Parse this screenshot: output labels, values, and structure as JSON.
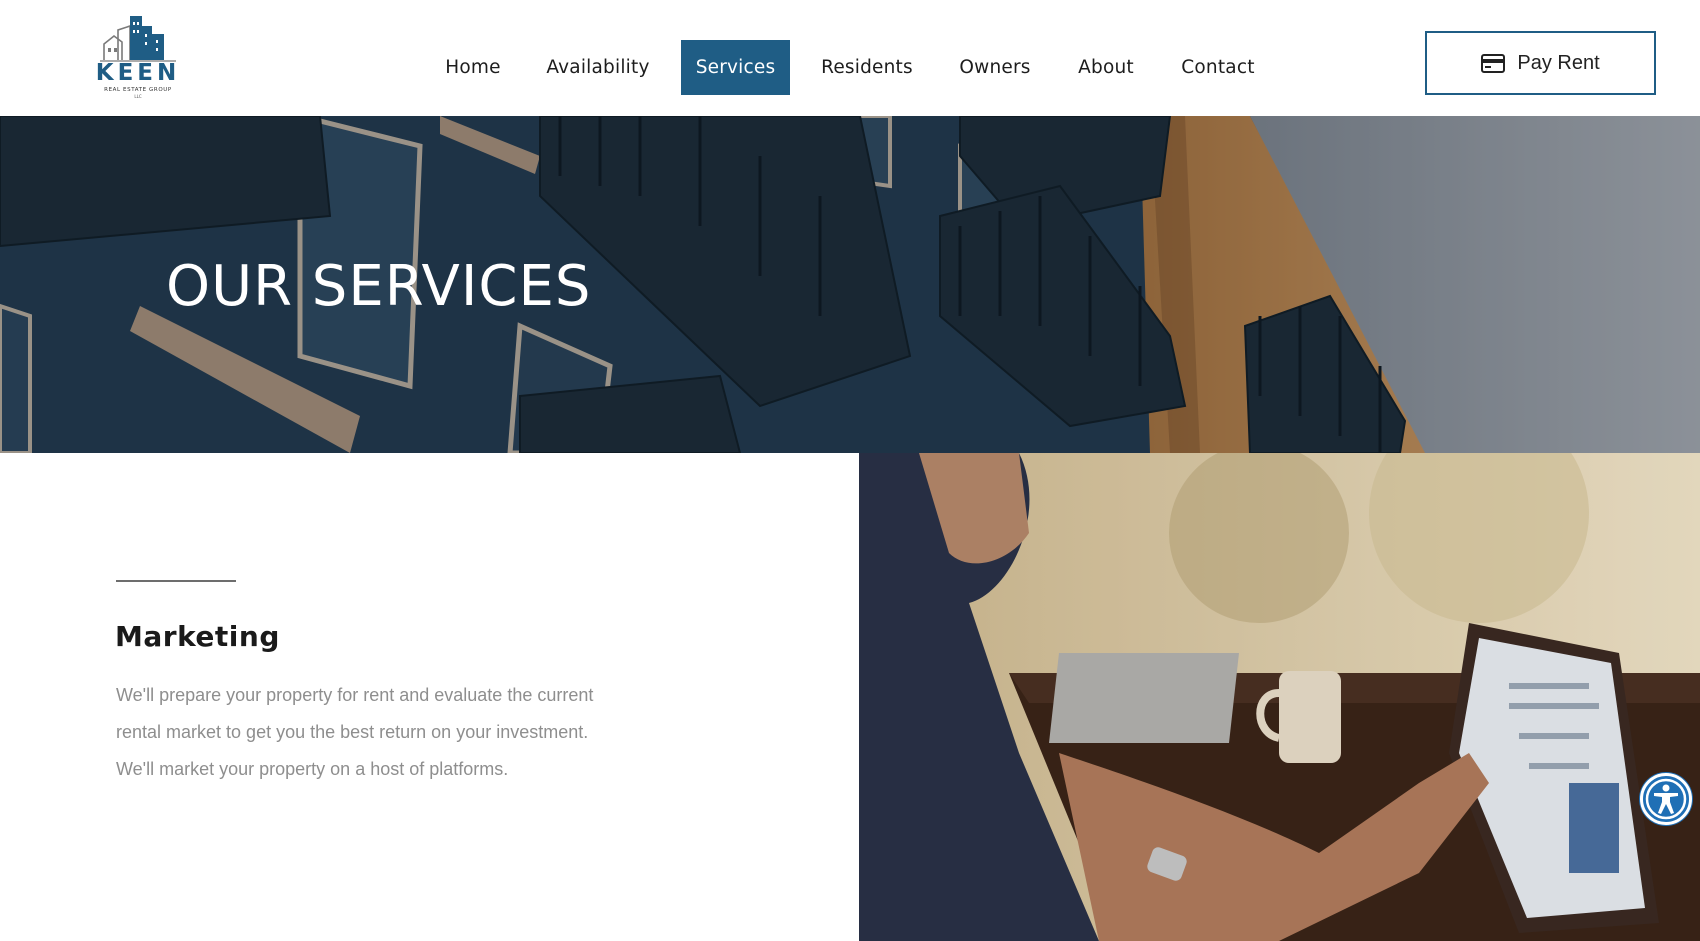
{
  "brand": {
    "name": "KEEN",
    "tagline": "REAL ESTATE GROUP",
    "suffix": "LLC",
    "color": "#1f5d85"
  },
  "nav": {
    "items": [
      {
        "label": "Home",
        "active": false
      },
      {
        "label": "Availability",
        "active": false
      },
      {
        "label": "Services",
        "active": true
      },
      {
        "label": "Residents",
        "active": false
      },
      {
        "label": "Owners",
        "active": false
      },
      {
        "label": "About",
        "active": false
      },
      {
        "label": "Contact",
        "active": false
      }
    ]
  },
  "pay_rent": {
    "label": "Pay Rent",
    "icon": "credit-card-icon"
  },
  "hero": {
    "title": "OUR SERVICES"
  },
  "section": {
    "title": "Marketing",
    "body": "We'll prepare your property for rent and evaluate the current rental market to get you the best return on your investment. We'll market your property on a host of platforms."
  },
  "accessibility": {
    "icon": "accessibility-icon",
    "color": "#1f6fb5"
  }
}
